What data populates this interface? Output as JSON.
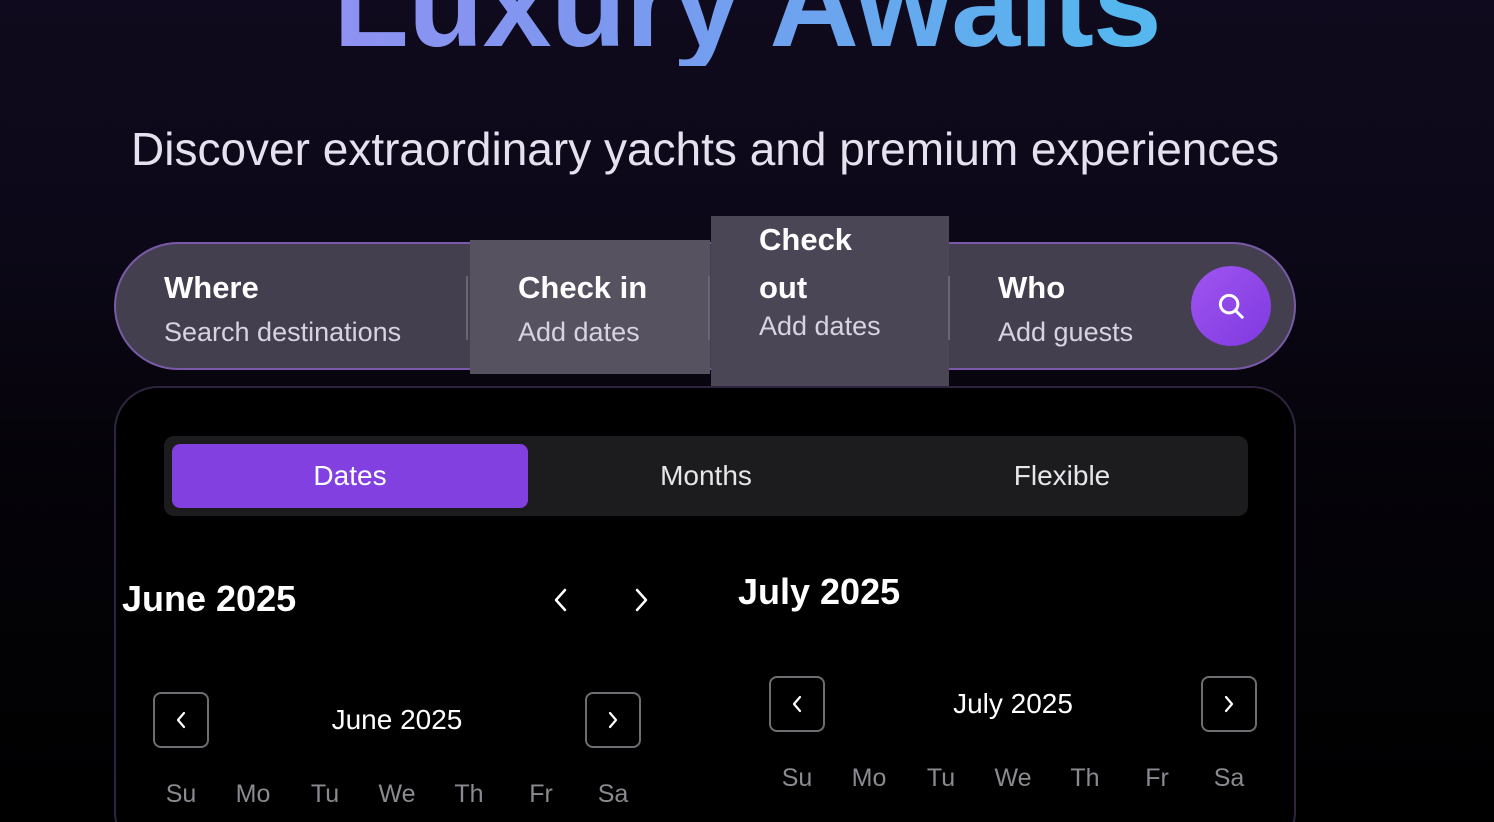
{
  "hero": {
    "title": "Luxury Awaits",
    "subtitle": "Discover extraordinary yachts and premium experiences"
  },
  "search": {
    "where": {
      "title": "Where",
      "placeholder": "Search destinations"
    },
    "check_in": {
      "title": "Check in",
      "placeholder": "Add dates"
    },
    "check_out": {
      "title_line1": "Check",
      "title_line2": "out",
      "placeholder": "Add dates"
    },
    "who": {
      "title": "Who",
      "placeholder": "Add guests"
    },
    "button_icon": "search-icon"
  },
  "date_picker": {
    "tabs": [
      {
        "label": "Dates",
        "active": true
      },
      {
        "label": "Months",
        "active": false
      },
      {
        "label": "Flexible",
        "active": false
      }
    ],
    "headers": [
      "June 2025",
      "July 2025"
    ],
    "calendars": [
      {
        "month_label": "June 2025"
      },
      {
        "month_label": "July 2025"
      }
    ],
    "weekdays": [
      "Su",
      "Mo",
      "Tu",
      "We",
      "Th",
      "Fr",
      "Sa"
    ]
  },
  "colors": {
    "accent": "#8340e0",
    "search_button": "#9f55f0",
    "background": "#0f0a1d"
  }
}
